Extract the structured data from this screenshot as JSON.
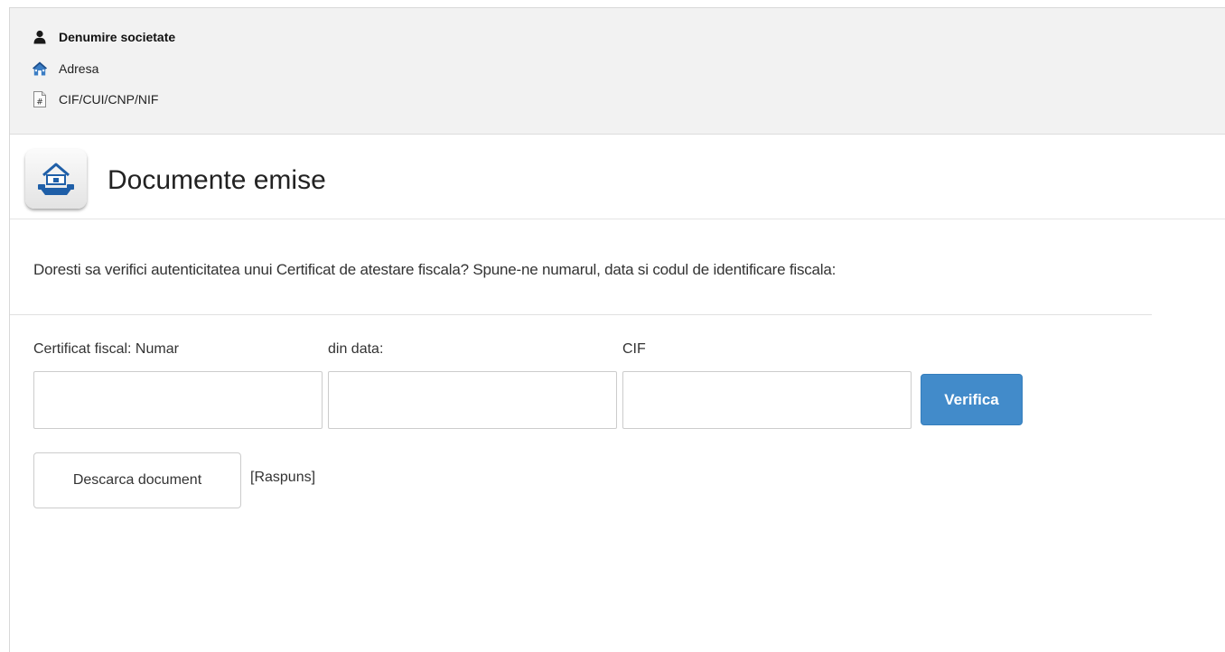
{
  "company": {
    "name_label": "Denumire societate",
    "address_label": "Adresa",
    "id_label": "CIF/CUI/CNP/NIF",
    "icons": {
      "name": "user-icon",
      "address": "home-icon",
      "id": "document-hash-icon"
    }
  },
  "section": {
    "title": "Documente emise",
    "icon": "house-document-icon"
  },
  "verify_form": {
    "question": "Doresti sa verifici autenticitatea unui Certificat de atestare fiscala? Spune-ne numarul, data si codul de identificare fiscala:",
    "number_label": "Certificat fiscal: Numar",
    "date_label": "din data:",
    "cif_label": "CIF",
    "number_value": "",
    "date_value": "",
    "cif_value": "",
    "verify_button": "Verifica",
    "download_button": "Descarca document",
    "response_text": "[Raspuns]"
  },
  "colors": {
    "primary_button": "#428bca",
    "header_background": "#f2f2f2",
    "icon_blue": "#1f5fa8"
  }
}
